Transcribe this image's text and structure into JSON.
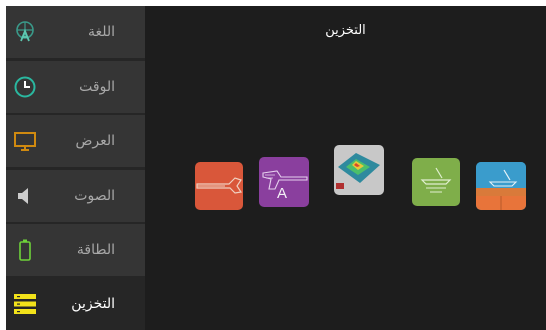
{
  "sidebar": {
    "items": [
      {
        "label": "اللغة",
        "icon": "language-globe-icon",
        "icon_color": "#3a9a8a"
      },
      {
        "label": "الوقت",
        "icon": "clock-icon",
        "icon_color": "#2ab8a0"
      },
      {
        "label": "العرض",
        "icon": "monitor-icon",
        "icon_color": "#d08a10"
      },
      {
        "label": "الصوت",
        "icon": "speaker-icon",
        "icon_color": "#cccccc"
      },
      {
        "label": "الطاقة",
        "icon": "battery-icon",
        "icon_color": "#6ed23a"
      },
      {
        "label": "التخزين",
        "icon": "storage-stack-icon",
        "icon_color": "#f2e21a",
        "active": true
      }
    ]
  },
  "main": {
    "title": "التخزين",
    "tiles": [
      {
        "name": "detector-mode-tile",
        "color": "#d9573a"
      },
      {
        "name": "detector-a-mode-tile",
        "color": "#8a3f9e",
        "letter": "A"
      },
      {
        "name": "3d-scan-tile",
        "color": "#c8c8c8"
      },
      {
        "name": "pinpoint-tile",
        "color": "#7fae4a"
      },
      {
        "name": "ground-scan-tile",
        "color": "#2a8fb8"
      }
    ]
  }
}
